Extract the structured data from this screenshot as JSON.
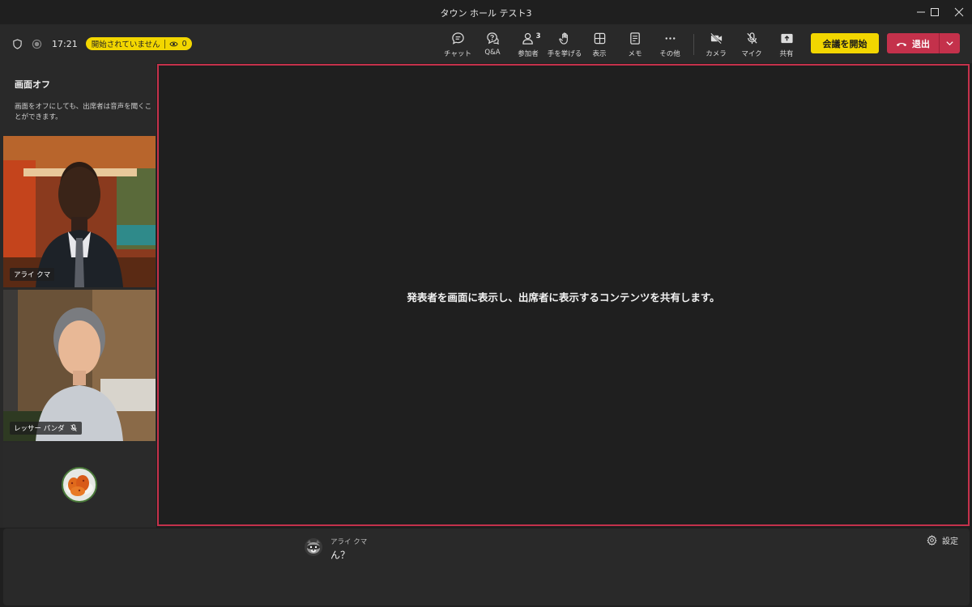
{
  "window": {
    "title": "タウン ホール テスト3",
    "controls": [
      "minimize-icon",
      "maximize-icon",
      "close-icon"
    ]
  },
  "toolbar": {
    "time": "17:21",
    "status_text": "開始されていません",
    "viewer_count": "0",
    "buttons": [
      {
        "label": "チャット",
        "icon": "chat-icon"
      },
      {
        "label": "Q&A",
        "icon": "qa-icon"
      },
      {
        "label": "参加者",
        "icon": "people-icon",
        "badge": "3"
      },
      {
        "label": "手を挙げる",
        "icon": "raise-hand-icon"
      },
      {
        "label": "表示",
        "icon": "view-icon"
      },
      {
        "label": "メモ",
        "icon": "notes-icon"
      },
      {
        "label": "その他",
        "icon": "more-icon"
      },
      {
        "label": "カメラ",
        "icon": "camera-off-icon"
      },
      {
        "label": "マイク",
        "icon": "mic-off-icon"
      },
      {
        "label": "共有",
        "icon": "share-icon"
      }
    ],
    "start_label": "会議を開始",
    "leave_label": "退出"
  },
  "left_panel": {
    "title": "画面オフ",
    "description": "画面をオフにしても、出席者は音声を聞くことができます。",
    "participants": [
      {
        "name": "アライ クマ",
        "muted": false
      },
      {
        "name": "レッサー パンダ",
        "muted": true
      }
    ]
  },
  "stage": {
    "message": "発表者を画面に表示し、出席者に表示するコンテンツを共有します。"
  },
  "chat": {
    "sender": "アライ クマ",
    "message": "ん？"
  },
  "settings_label": "設定",
  "colors": {
    "accent_yellow": "#f2d600",
    "leave_red": "#c4314b",
    "stage_border": "#c4314b",
    "background": "#1f1f1f",
    "panel": "#292929"
  }
}
